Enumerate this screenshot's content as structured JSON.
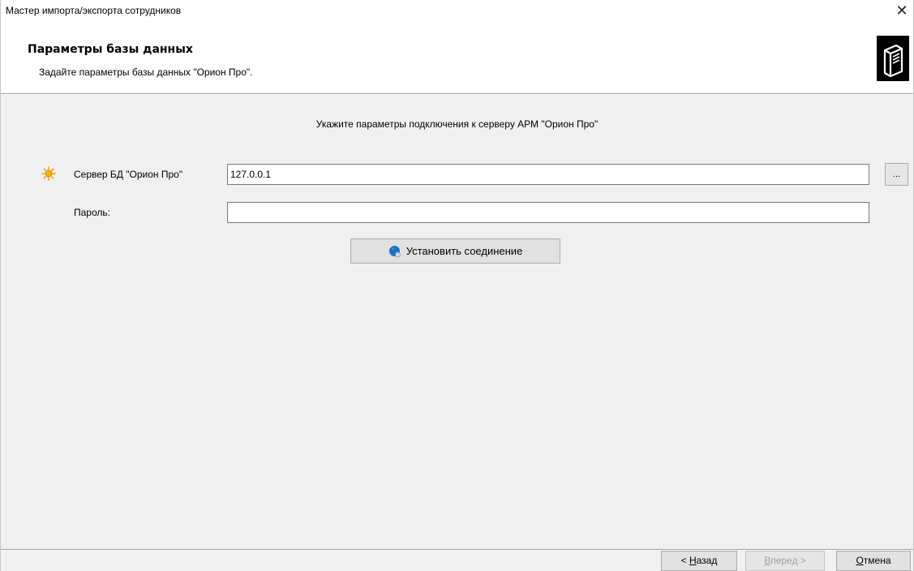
{
  "window": {
    "title": "Мастер импорта/экспорта сотрудников",
    "close_glyph": "✕"
  },
  "header": {
    "title": "Параметры базы данных",
    "subtitle": "Задайте параметры базы данных \"Орион Про\".",
    "icon": "server-icon"
  },
  "main": {
    "instruction": "Укажите параметры подключения к серверу АРМ \"Орион Про\"",
    "server": {
      "icon": "warning-sun-icon",
      "label": "Сервер БД \"Орион Про\"",
      "value": "127.0.0.1",
      "browse_label": "..."
    },
    "password": {
      "label": "Пароль:",
      "value": ""
    },
    "connect_button": {
      "icon": "globe-icon",
      "label": "Установить соединение"
    }
  },
  "footer": {
    "back": {
      "prefix": "< ",
      "hotkey": "Н",
      "rest": "азад"
    },
    "next": {
      "hotkey": "В",
      "rest": "перед",
      "suffix": " >",
      "disabled": true
    },
    "cancel": {
      "hotkey": "О",
      "rest": "тмена"
    }
  },
  "colors": {
    "panel_bg": "#f0f0f0",
    "button_bg": "#e1e1e1",
    "border": "#adadad",
    "warn_orange": "#f5a000",
    "globe_blue": "#1a6ed8"
  }
}
